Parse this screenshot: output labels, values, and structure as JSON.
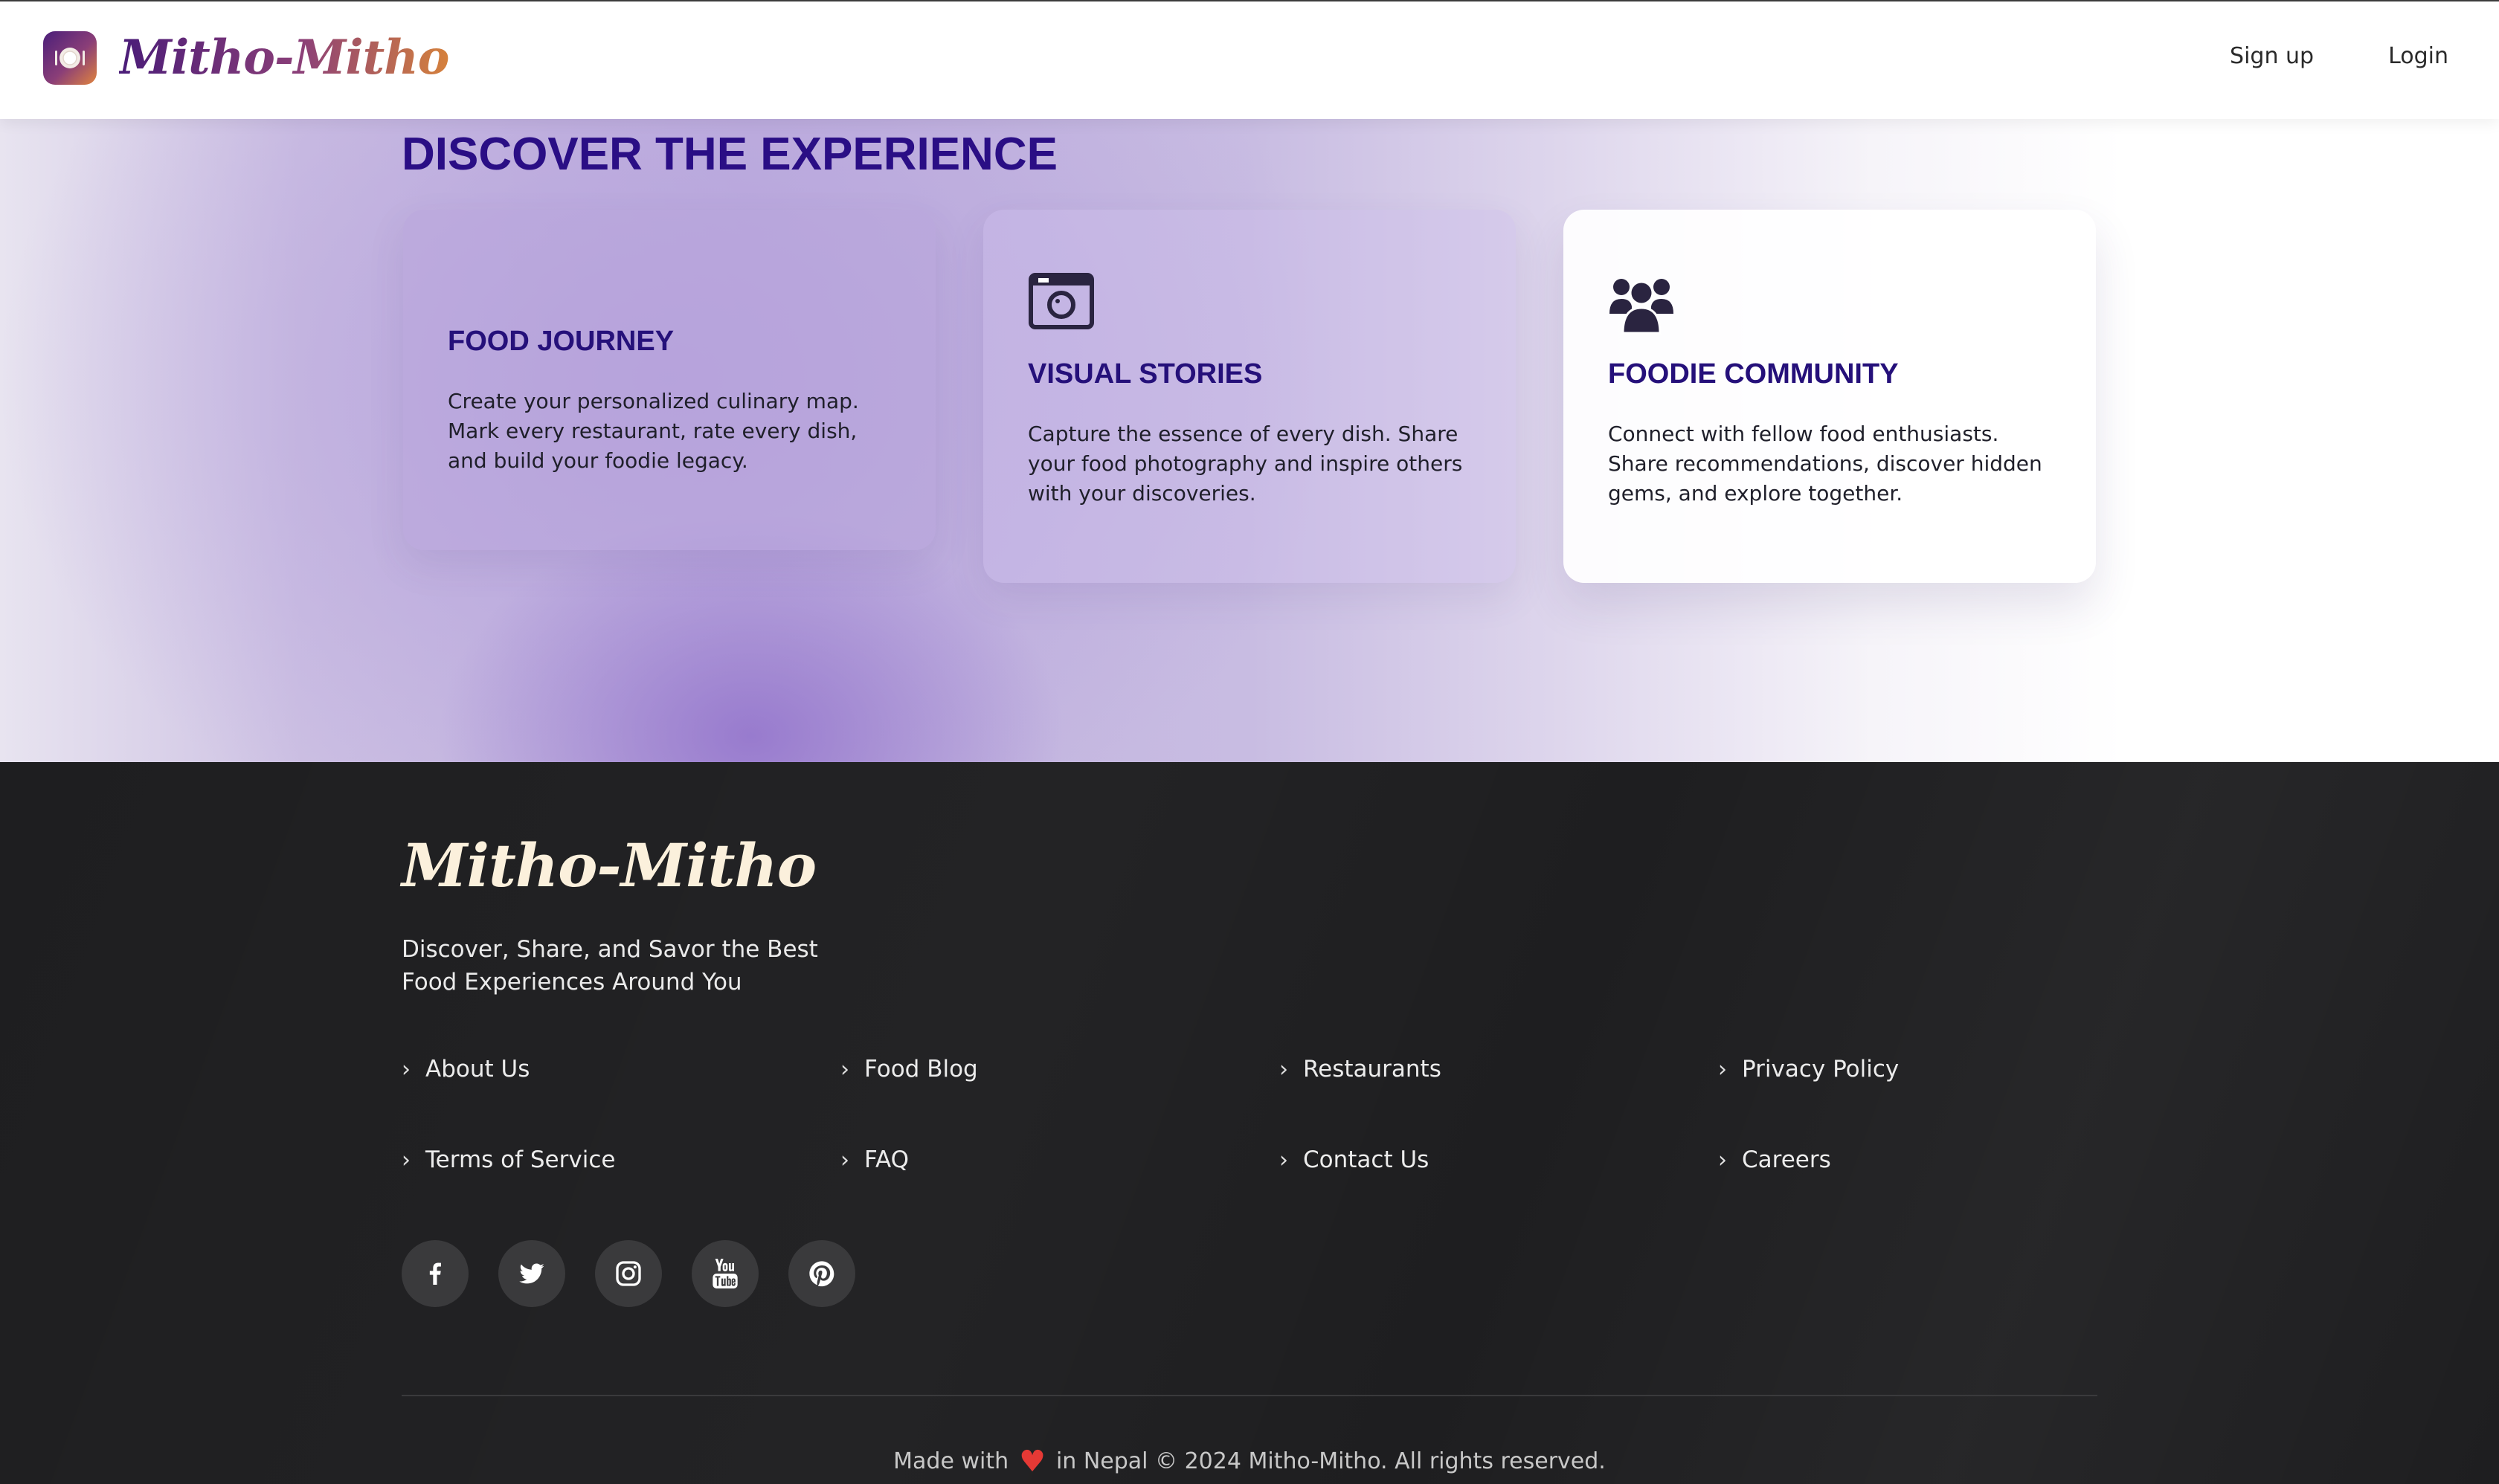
{
  "header": {
    "brand": "Mitho-Mitho",
    "nav": {
      "signup": "Sign up",
      "login": "Login"
    }
  },
  "discover": {
    "title": "DISCOVER THE EXPERIENCE",
    "cards": [
      {
        "icon": "map-icon",
        "title": "FOOD JOURNEY",
        "description": "Create your personalized culinary map. Mark every restaurant, rate every dish, and build your foodie legacy."
      },
      {
        "icon": "camera-icon",
        "title": "VISUAL STORIES",
        "description": "Capture the essence of every dish. Share your food photography and inspire others with your discoveries."
      },
      {
        "icon": "users-icon",
        "title": "FOODIE COMMUNITY",
        "description": "Connect with fellow food enthusiasts. Share recommendations, discover hidden gems, and explore together."
      }
    ]
  },
  "footer": {
    "brand": "Mitho-Mitho",
    "tagline": "Discover, Share, and Savor the Best Food Experiences Around You",
    "links": [
      "About Us",
      "Food Blog",
      "Restaurants",
      "Privacy Policy",
      "Terms of Service",
      "FAQ",
      "Contact Us",
      "Careers"
    ],
    "social": [
      "facebook-icon",
      "twitter-icon",
      "instagram-icon",
      "youtube-icon",
      "pinterest-icon"
    ],
    "copyright": {
      "before": "Made with",
      "heart": "♥",
      "after": "in Nepal © 2024 Mitho-Mitho. All rights reserved."
    }
  },
  "colors": {
    "accent": "#2a0e85",
    "footer_bg": "#1e1e20",
    "heart": "#e53935"
  }
}
